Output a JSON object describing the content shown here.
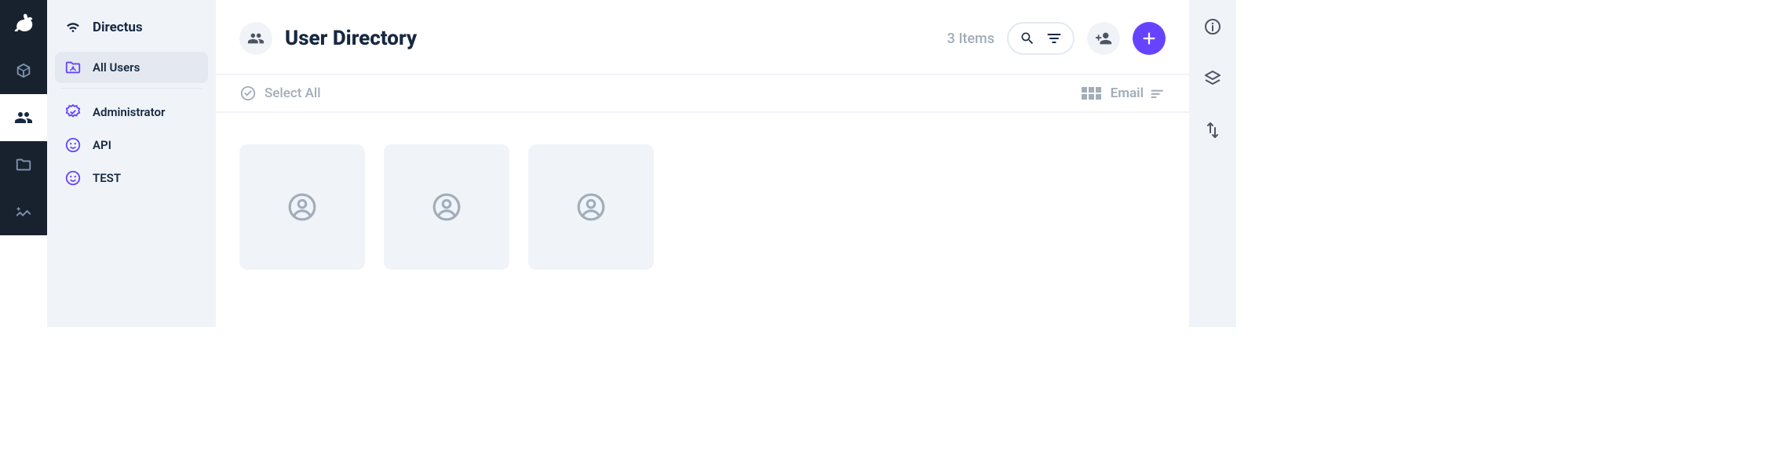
{
  "nav": {
    "project_name": "Directus",
    "items": [
      {
        "label": "All Users",
        "active": true,
        "icon": "folder-user"
      },
      {
        "label": "Administrator",
        "active": false,
        "icon": "verified"
      },
      {
        "label": "API",
        "active": false,
        "icon": "face"
      },
      {
        "label": "TEST",
        "active": false,
        "icon": "face"
      }
    ]
  },
  "header": {
    "title": "User Directory",
    "item_count_label": "3 Items"
  },
  "toolbar": {
    "select_all_label": "Select All",
    "sort_field_label": "Email"
  },
  "users": [
    {
      "avatar": null
    },
    {
      "avatar": null
    },
    {
      "avatar": null
    }
  ],
  "module_bar": {
    "active_index": 1,
    "modules": [
      "content",
      "users",
      "files",
      "insights"
    ]
  },
  "right_sidebar": {
    "buttons": [
      "info",
      "layers",
      "import-export"
    ]
  },
  "colors": {
    "accent": "#6644ff",
    "dark": "#18222f",
    "text": "#172940",
    "muted": "#a2adba",
    "surface": "#f0f4f9"
  }
}
